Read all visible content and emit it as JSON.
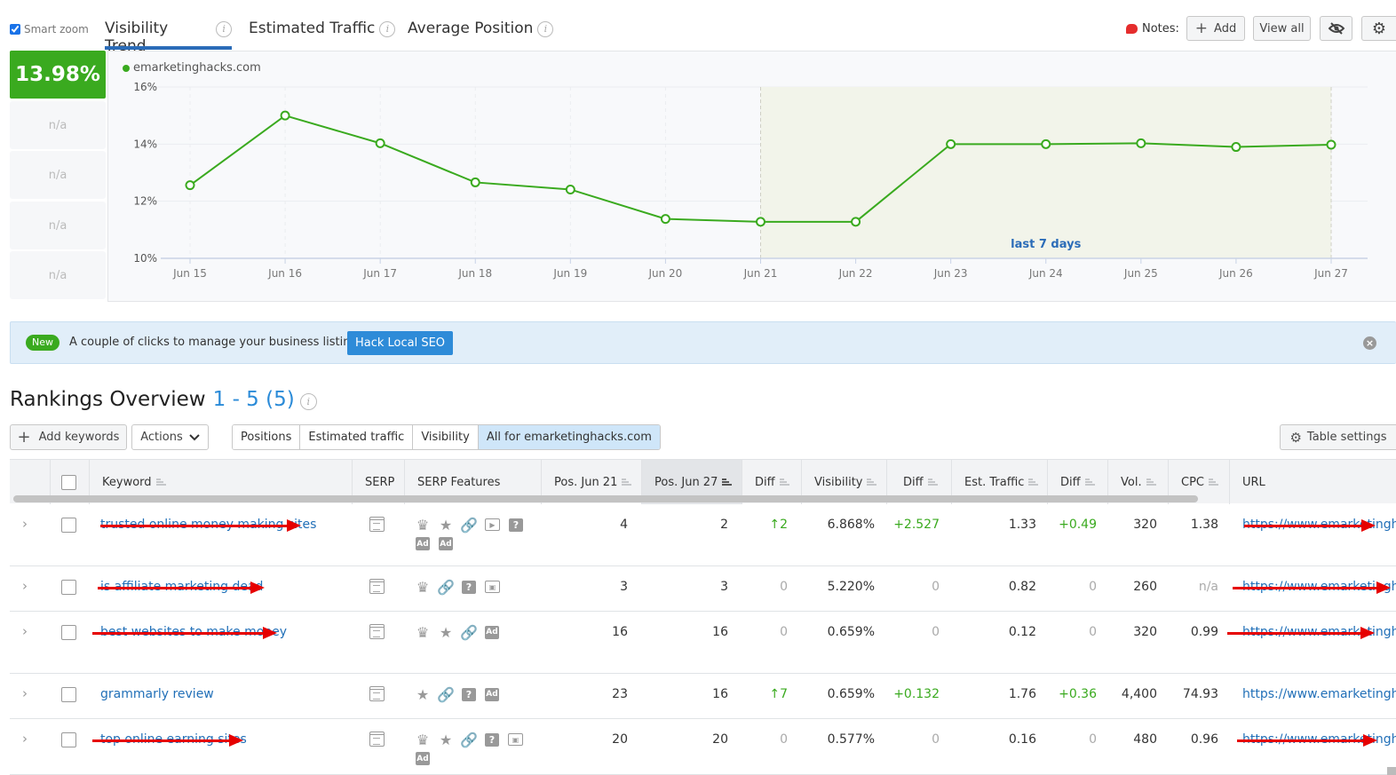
{
  "top": {
    "smart_zoom_label": "Smart zoom",
    "smart_zoom_checked": true,
    "tabs": [
      {
        "label": "Visibility Trend",
        "active": true
      },
      {
        "label": "Estimated Traffic",
        "active": false
      },
      {
        "label": "Average Position",
        "active": false
      }
    ],
    "info_glyph": "i",
    "notes_label": "Notes:",
    "add_label": "Add",
    "add_icon": "+",
    "view_all_label": "View all",
    "hide_icon": "eye-slash-icon",
    "settings_icon": "gear-icon"
  },
  "summary": {
    "score": "13.98%",
    "na_values": [
      "n/a",
      "n/a",
      "n/a",
      "n/a"
    ]
  },
  "chart_data": {
    "type": "line",
    "title": "Visibility Trend",
    "legend": [
      "emarketinghacks.com"
    ],
    "legend_position": "top-left",
    "x": [
      "Jun 15",
      "Jun 16",
      "Jun 17",
      "Jun 18",
      "Jun 19",
      "Jun 20",
      "Jun 21",
      "Jun 22",
      "Jun 23",
      "Jun 24",
      "Jun 25",
      "Jun 26",
      "Jun 27"
    ],
    "series": [
      {
        "name": "emarketinghacks.com",
        "color": "#3aaa1f",
        "values": [
          12.56,
          15.0,
          14.03,
          12.66,
          12.41,
          11.38,
          11.28,
          11.28,
          14.0,
          14.0,
          14.03,
          13.9,
          13.98
        ]
      }
    ],
    "yticks": [
      "10%",
      "12%",
      "14%",
      "16%"
    ],
    "ytick_values": [
      10,
      12,
      14,
      16
    ],
    "ylim": [
      10,
      16
    ],
    "grid": true,
    "highlight": {
      "from": "Jun 21",
      "to": "Jun 27",
      "label": "last 7 days"
    }
  },
  "banner": {
    "badge": "New",
    "message": "A couple of clicks to manage your business listings.",
    "button": "Hack Local SEO",
    "close_glyph": "×"
  },
  "rankings": {
    "title": "Rankings Overview",
    "count": "1 - 5 (5)",
    "add_keywords": "Add keywords",
    "actions": "Actions",
    "actions_chevron": "⌄",
    "segments": [
      "Positions",
      "Estimated traffic",
      "Visibility",
      "All for emarketinghacks.com"
    ],
    "table_settings": "Table settings",
    "columns": [
      "Keyword",
      "SERP",
      "SERP Features",
      "Pos. Jun 21",
      "Pos. Jun 27",
      "Diff",
      "Visibility",
      "Diff",
      "Est. Traffic",
      "Diff",
      "Vol.",
      "CPC",
      "URL"
    ],
    "rows": [
      {
        "keyword": "trusted online money making sites",
        "redacted": true,
        "features": [
          "crown",
          "star",
          "link",
          "video",
          "question"
        ],
        "features2": [
          "ad-top",
          "ad-bottom"
        ],
        "pos21": "4",
        "pos27": "2",
        "diff": "↑2",
        "diff_up": true,
        "visibility": "6.868%",
        "vis_diff": "+2.527",
        "traffic": "1.33",
        "traffic_diff": "+0.49",
        "vol": "320",
        "cpc": "1.38",
        "url": "https://www.emarketinghacks.com",
        "url_redacted": true
      },
      {
        "keyword": "is affiliate marketing dead",
        "redacted": true,
        "features": [
          "crown",
          "link",
          "question",
          "image"
        ],
        "features2": [],
        "pos21": "3",
        "pos27": "3",
        "diff": "0",
        "diff_up": false,
        "visibility": "5.220%",
        "vis_diff": "0",
        "traffic": "0.82",
        "traffic_diff": "0",
        "vol": "260",
        "cpc": "n/a",
        "url": "https://www.emarketinghacks.com",
        "url_redacted": true
      },
      {
        "keyword": "best websites to make money",
        "redacted": true,
        "features": [
          "crown",
          "star",
          "link",
          "ad-top"
        ],
        "features2": [],
        "pos21": "16",
        "pos27": "16",
        "diff": "0",
        "diff_up": false,
        "visibility": "0.659%",
        "vis_diff": "0",
        "traffic": "0.12",
        "traffic_diff": "0",
        "vol": "320",
        "cpc": "0.99",
        "url": "https://www.emarketinghacks.com",
        "url_redacted": true
      },
      {
        "keyword": "grammarly review",
        "redacted": false,
        "features": [
          "star",
          "link",
          "question",
          "ad-top"
        ],
        "features2": [],
        "pos21": "23",
        "pos27": "16",
        "diff": "↑7",
        "diff_up": true,
        "visibility": "0.659%",
        "vis_diff": "+0.132",
        "traffic": "1.76",
        "traffic_diff": "+0.36",
        "vol": "4,400",
        "cpc": "74.93",
        "url": "https://www.emarketinghacks.com",
        "url_redacted": false
      },
      {
        "keyword": "top online earning sites",
        "redacted": true,
        "features": [
          "crown",
          "star",
          "link",
          "question",
          "image"
        ],
        "features2": [
          "ad-bottom"
        ],
        "pos21": "20",
        "pos27": "20",
        "diff": "0",
        "diff_up": false,
        "visibility": "0.577%",
        "vis_diff": "0",
        "traffic": "0.16",
        "traffic_diff": "0",
        "vol": "480",
        "cpc": "0.96",
        "url": "https://www.emarketinghacks.com",
        "url_redacted": true
      }
    ]
  }
}
